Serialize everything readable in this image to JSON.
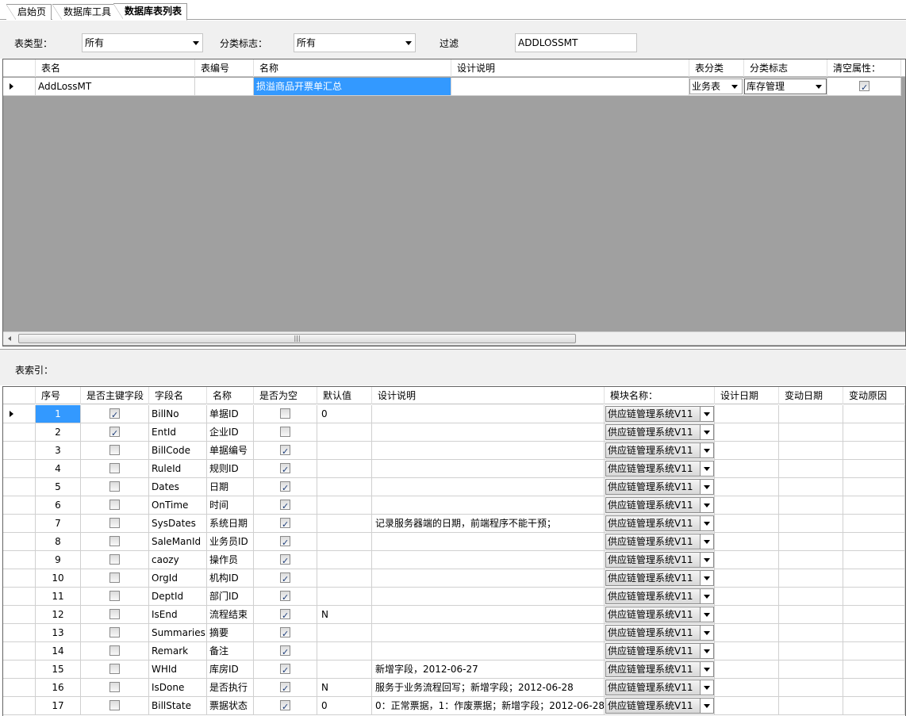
{
  "tabs": [
    {
      "label": "启始页",
      "active": false
    },
    {
      "label": "数据库工具",
      "active": false
    },
    {
      "label": "数据库表列表",
      "active": true
    }
  ],
  "filters": {
    "table_type_label": "表类型：",
    "table_type_value": "所有",
    "category_label": "分类标志：",
    "category_value": "所有",
    "filter_label": "过滤",
    "filter_value": "ADDLOSSMT"
  },
  "tables_grid": {
    "columns": [
      "表名",
      "表编号",
      "名称",
      "设计说明",
      "表分类",
      "分类标志",
      "清空属性："
    ],
    "rows": [
      {
        "table_name": "AddLossMT",
        "table_no": "",
        "name": "损溢商品开票单汇总",
        "description": "",
        "table_class": "业务表",
        "category": "库存管理",
        "clear_attr": true
      }
    ]
  },
  "index_label": "表索引：",
  "fields_grid": {
    "columns": [
      "序号",
      "是否主键字段",
      "字段名",
      "名称",
      "是否为空",
      "默认值",
      "设计说明",
      "模块名称：",
      "设计日期",
      "变动日期",
      "变动原因"
    ],
    "rows": [
      {
        "no": "1",
        "pk": true,
        "field": "BillNo",
        "name": "单据ID",
        "nullable": false,
        "default": "0",
        "desc": "",
        "module": "供应链管理系统V11"
      },
      {
        "no": "2",
        "pk": true,
        "field": "EntId",
        "name": "企业ID",
        "nullable": false,
        "default": "",
        "desc": "",
        "module": "供应链管理系统V11"
      },
      {
        "no": "3",
        "pk": false,
        "field": "BillCode",
        "name": "单据编号",
        "nullable": true,
        "default": "",
        "desc": "",
        "module": "供应链管理系统V11"
      },
      {
        "no": "4",
        "pk": false,
        "field": "RuleId",
        "name": "规则ID",
        "nullable": true,
        "default": "",
        "desc": "",
        "module": "供应链管理系统V11"
      },
      {
        "no": "5",
        "pk": false,
        "field": "Dates",
        "name": "日期",
        "nullable": true,
        "default": "",
        "desc": "",
        "module": "供应链管理系统V11"
      },
      {
        "no": "6",
        "pk": false,
        "field": "OnTime",
        "name": "时间",
        "nullable": true,
        "default": "",
        "desc": "",
        "module": "供应链管理系统V11"
      },
      {
        "no": "7",
        "pk": false,
        "field": "SysDates",
        "name": "系统日期",
        "nullable": true,
        "default": "",
        "desc": "记录服务器端的日期，前端程序不能干预；",
        "module": "供应链管理系统V11"
      },
      {
        "no": "8",
        "pk": false,
        "field": "SaleManId",
        "name": "业务员ID",
        "nullable": true,
        "default": "",
        "desc": "",
        "module": "供应链管理系统V11"
      },
      {
        "no": "9",
        "pk": false,
        "field": "caozy",
        "name": "操作员",
        "nullable": true,
        "default": "",
        "desc": "",
        "module": "供应链管理系统V11"
      },
      {
        "no": "10",
        "pk": false,
        "field": "OrgId",
        "name": "机构ID",
        "nullable": true,
        "default": "",
        "desc": "",
        "module": "供应链管理系统V11"
      },
      {
        "no": "11",
        "pk": false,
        "field": "DeptId",
        "name": "部门ID",
        "nullable": true,
        "default": "",
        "desc": "",
        "module": "供应链管理系统V11"
      },
      {
        "no": "12",
        "pk": false,
        "field": "IsEnd",
        "name": "流程结束",
        "nullable": true,
        "default": "N",
        "desc": "",
        "module": "供应链管理系统V11"
      },
      {
        "no": "13",
        "pk": false,
        "field": "Summaries",
        "name": "摘要",
        "nullable": true,
        "default": "",
        "desc": "",
        "module": "供应链管理系统V11"
      },
      {
        "no": "14",
        "pk": false,
        "field": "Remark",
        "name": "备注",
        "nullable": true,
        "default": "",
        "desc": "",
        "module": "供应链管理系统V11"
      },
      {
        "no": "15",
        "pk": false,
        "field": "WHId",
        "name": "库房ID",
        "nullable": true,
        "default": "",
        "desc": "新增字段，2012-06-27",
        "module": "供应链管理系统V11"
      },
      {
        "no": "16",
        "pk": false,
        "field": "IsDone",
        "name": "是否执行",
        "nullable": true,
        "default": "N",
        "desc": "服务于业务流程回写；新增字段；2012-06-28",
        "module": "供应链管理系统V11"
      },
      {
        "no": "17",
        "pk": false,
        "field": "BillState",
        "name": "票据状态",
        "nullable": true,
        "default": "0",
        "desc": "0：正常票据，1：作废票据；新增字段；2012-06-28",
        "module": "供应链管理系统V11"
      }
    ]
  },
  "colors": {
    "selected": "#3399ff",
    "grid_empty": "#a0a0a0",
    "panel": "#f0f0f0"
  }
}
